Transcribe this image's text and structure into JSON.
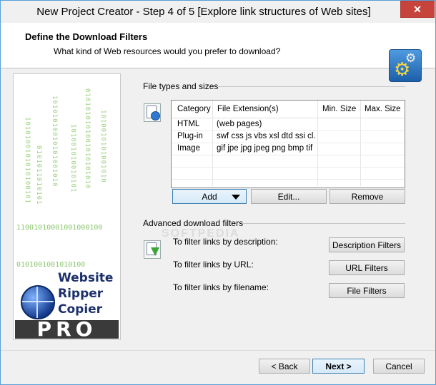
{
  "window": {
    "title": "New Project Creator - Step 4 of 5 [Explore link structures of Web sites]",
    "close_glyph": "✕"
  },
  "header": {
    "title": "Define the Download Filters",
    "subtitle": "What kind of Web resources would you prefer to download?",
    "icon": "gears-icon"
  },
  "side_banner": {
    "binary_row_1": "11001010001001000100",
    "binary_row_2": "0101001001010100",
    "brand_line_1": "Website",
    "brand_line_2": "Ripper",
    "brand_line_3": "Copier",
    "edition": "PRO"
  },
  "file_types": {
    "group_label": "File types and sizes",
    "columns": [
      "Category",
      "File Extension(s)",
      "Min. Size",
      "Max. Size"
    ],
    "rows": [
      {
        "category": "HTML",
        "extensions": "(web pages)",
        "min": "",
        "max": ""
      },
      {
        "category": "Plug-in",
        "extensions": "swf css js vbs xsl dtd ssi cl...",
        "min": "",
        "max": ""
      },
      {
        "category": "Image",
        "extensions": "gif jpe jpg jpeg png bmp tif ...",
        "min": "",
        "max": ""
      }
    ],
    "add_label": "Add",
    "edit_label": "Edit...",
    "remove_label": "Remove"
  },
  "advanced": {
    "group_label": "Advanced download  filters",
    "watermark": "SOFTPEDIA",
    "desc_text": "To filter links by description:",
    "url_text": "To filter links by URL:",
    "file_text": "To filter links by filename:",
    "desc_button": "Description Filters",
    "url_button": "URL Filters",
    "file_button": "File Filters"
  },
  "footer": {
    "back_label": "< Back",
    "next_label": "Next >",
    "cancel_label": "Cancel"
  }
}
